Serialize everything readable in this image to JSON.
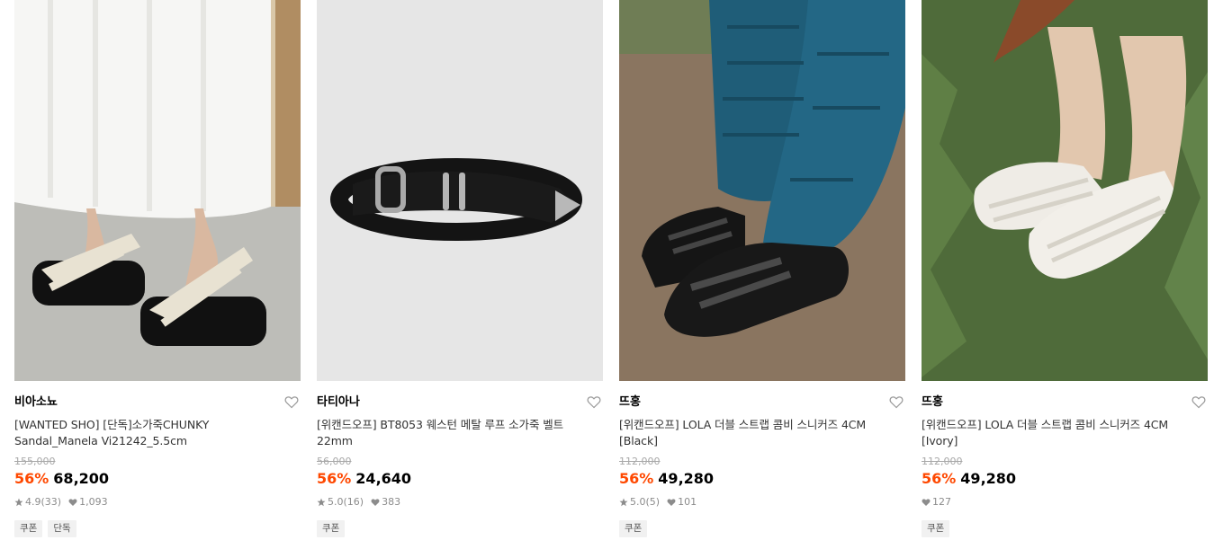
{
  "colors": {
    "discount": "#ff4800",
    "strike": "#a8a8a8",
    "meta": "#8c8c8c",
    "tag_bg": "#f1f1f1"
  },
  "products": [
    {
      "image_alt": "sandal-photo",
      "brand": "비아소뇨",
      "title_line1": "[WANTED SHO] [단독]소가죽CHUNKY",
      "title_line2": "Sandal_Manela Vi21242_5.5cm",
      "original_price": "155,000",
      "discount": "56%",
      "price": "68,200",
      "rating": "4.9",
      "reviews": "(33)",
      "likes": "1,093",
      "tags": [
        "쿠폰",
        "단독"
      ]
    },
    {
      "image_alt": "belt-photo",
      "brand": "타티아나",
      "title_line1": "[위캔드오프] BT8053 웨스턴 메탈 루프 소가죽 벨트",
      "title_line2": "22mm",
      "original_price": "56,000",
      "discount": "56%",
      "price": "24,640",
      "rating": "5.0",
      "reviews": "(16)",
      "likes": "383",
      "tags": [
        "쿠폰"
      ]
    },
    {
      "image_alt": "black-sneakers-photo",
      "brand": "뜨홍",
      "title_line1": "[위캔드오프] LOLA 더블 스트랩 콤비 스니커즈 4CM",
      "title_line2": "[Black]",
      "original_price": "112,000",
      "discount": "56%",
      "price": "49,280",
      "rating": "5.0",
      "reviews": "(5)",
      "likes": "101",
      "tags": [
        "쿠폰"
      ]
    },
    {
      "image_alt": "ivory-sneakers-photo",
      "brand": "뜨홍",
      "title_line1": "[위캔드오프] LOLA 더블 스트랩 콤비 스니커즈 4CM",
      "title_line2": "[Ivory]",
      "original_price": "112,000",
      "discount": "56%",
      "price": "49,280",
      "likes": "127",
      "tags": [
        "쿠폰"
      ]
    }
  ]
}
